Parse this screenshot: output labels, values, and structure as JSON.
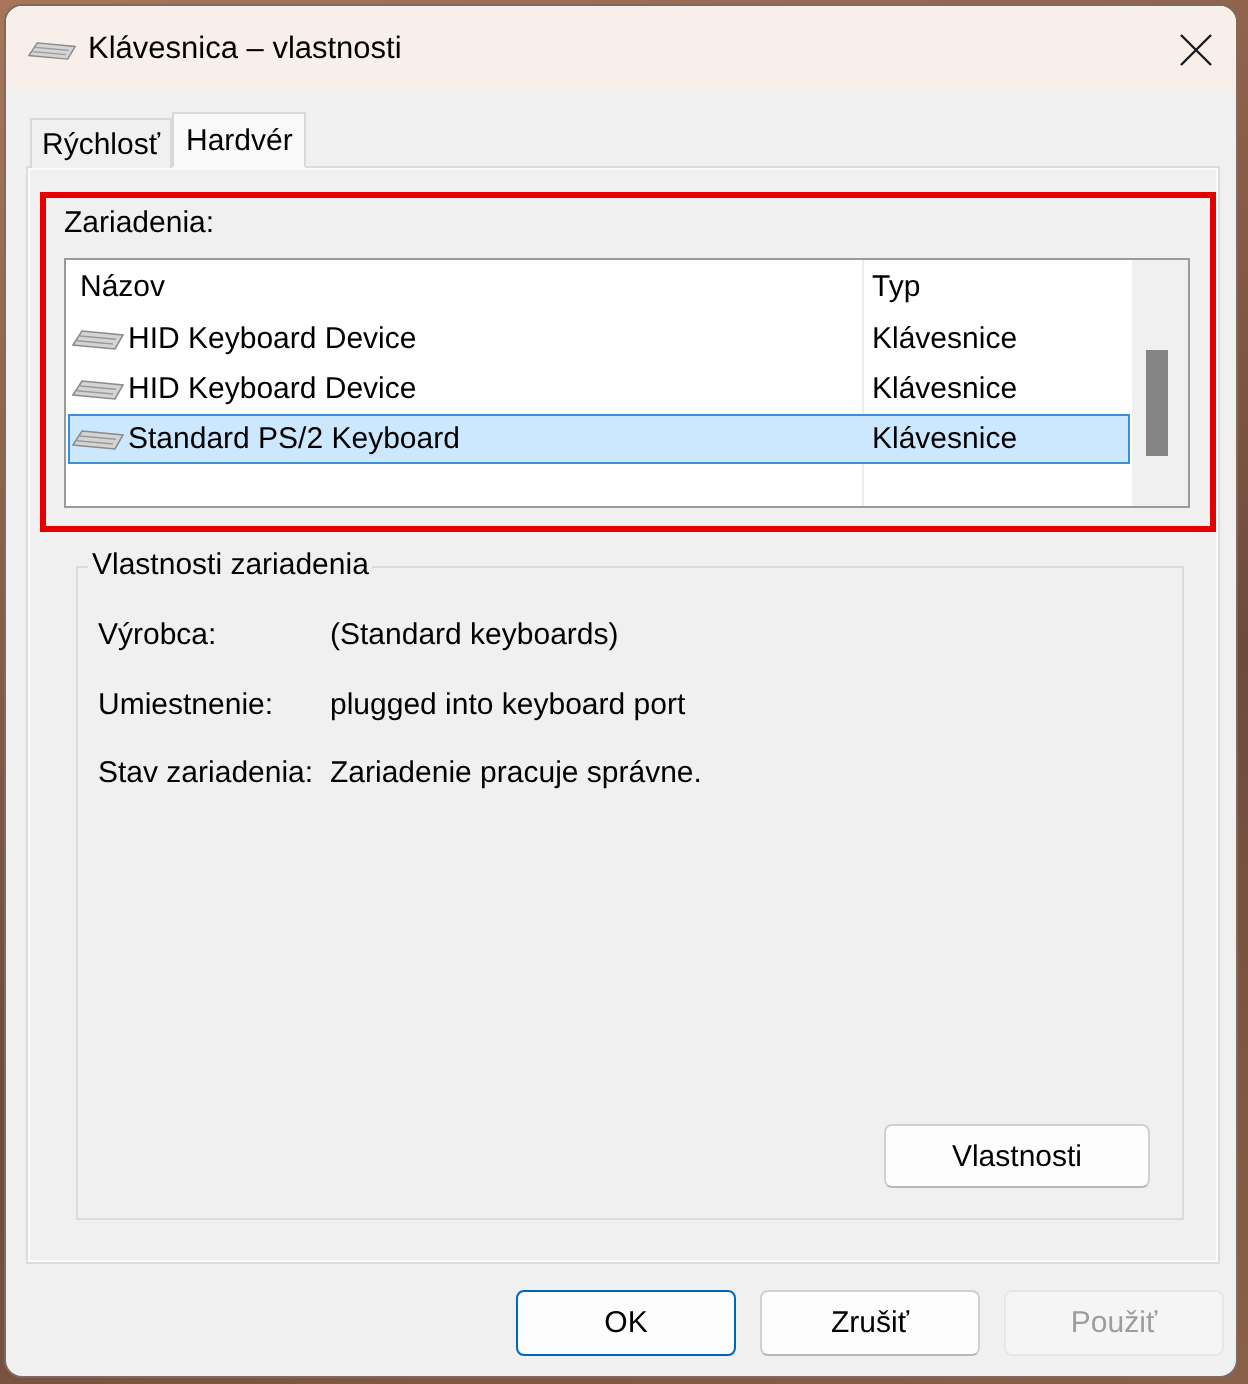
{
  "window": {
    "title": "Klávesnica – vlastnosti"
  },
  "tabs": [
    {
      "label": "Rýchlosť",
      "selected": false
    },
    {
      "label": "Hardvér",
      "selected": true
    }
  ],
  "devices": {
    "label": "Zariadenia:",
    "highlighted": true,
    "columns": [
      "Názov",
      "Typ"
    ],
    "rows": [
      {
        "name": "HID Keyboard Device",
        "type": "Klávesnice",
        "selected": false
      },
      {
        "name": "HID Keyboard Device",
        "type": "Klávesnice",
        "selected": false
      },
      {
        "name": "Standard PS/2 Keyboard",
        "type": "Klávesnice",
        "selected": true
      }
    ]
  },
  "device_properties": {
    "title": "Vlastnosti zariadenia",
    "fields": [
      {
        "label": "Výrobca:",
        "value": "(Standard keyboards)"
      },
      {
        "label": "Umiestnenie:",
        "value": "plugged into keyboard port"
      },
      {
        "label": "Stav zariadenia:",
        "value": "Zariadenie pracuje správne."
      }
    ],
    "button": "Vlastnosti"
  },
  "buttons": [
    {
      "label": "OK",
      "default": true,
      "disabled": false
    },
    {
      "label": "Zrušiť",
      "default": false,
      "disabled": false
    },
    {
      "label": "Použiť",
      "default": false,
      "disabled": true
    }
  ]
}
